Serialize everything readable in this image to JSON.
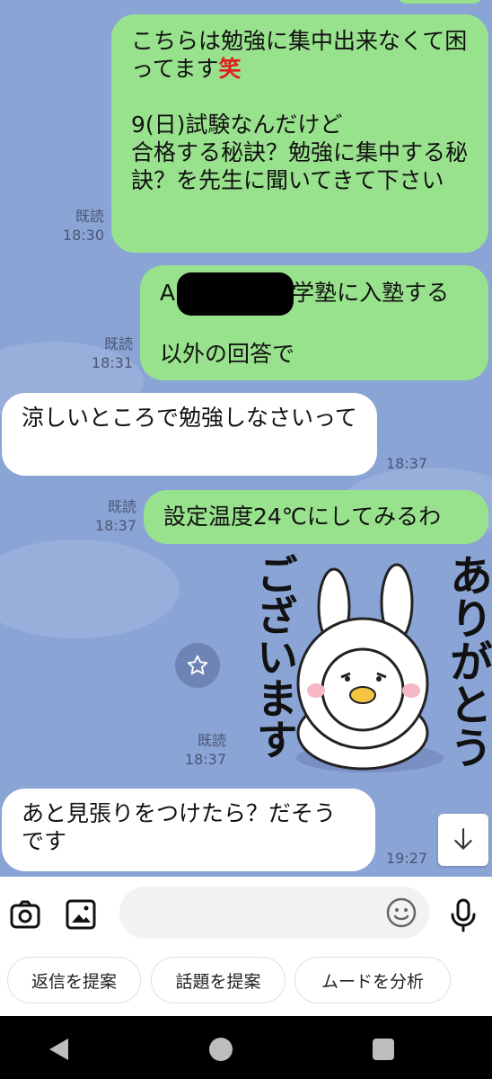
{
  "messages": {
    "m1": {
      "text": "こちらは勉強に集中出来なくて困ってます",
      "emoji_char": "笑",
      "text2": "9(日)試験なんだけど\n合格する秘訣？勉強に集中する秘訣？を先生に聞いてきて下さい",
      "read": "既読",
      "time": "18:30"
    },
    "m2": {
      "line1_prefix": "A",
      "line1_suffix": "学塾に入塾する",
      "line2": "以外の回答で",
      "read": "既読",
      "time": "18:31"
    },
    "m3": {
      "text": "涼しいところで勉強しなさいって",
      "time": "18:37"
    },
    "m4": {
      "text": "設定温度24℃にしてみるわ",
      "read": "既読",
      "time": "18:37"
    },
    "m5": {
      "sticker_text_right": "ありがとう",
      "sticker_text_left": "ございます",
      "read": "既読",
      "time": "18:37"
    },
    "m6": {
      "text": "あと見張りをつけたら？だそうです",
      "time": "19:27"
    }
  },
  "chips": [
    "返信を提案",
    "話題を提案",
    "ムードを分析"
  ],
  "icons": {
    "camera": "camera-icon",
    "image": "image-icon",
    "emoji": "emoji-icon",
    "mic": "microphone-icon",
    "star": "star-icon",
    "scroll": "arrow-down-icon",
    "back": "back-icon",
    "home": "home-icon",
    "recents": "recents-icon"
  },
  "colors": {
    "chat_bg": "#8aa4d6",
    "outgoing": "#99e28d",
    "incoming": "#ffffff",
    "emoji_red": "#e02020"
  }
}
